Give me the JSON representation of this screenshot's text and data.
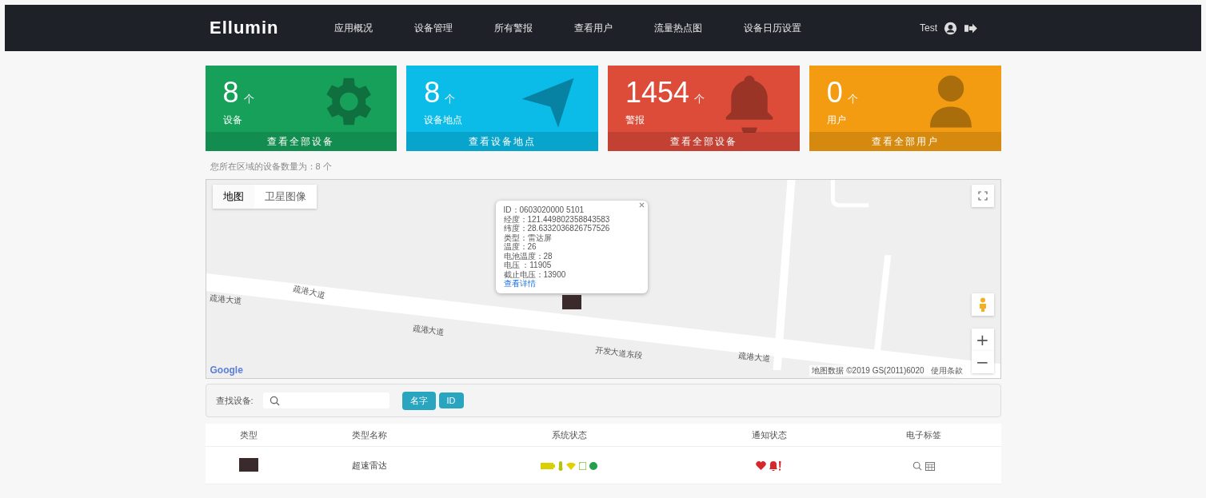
{
  "navbar": {
    "brand": "Ellumin",
    "items": [
      {
        "label": "应用概况"
      },
      {
        "label": "设备管理"
      },
      {
        "label": "所有警报"
      },
      {
        "label": "查看用户"
      },
      {
        "label": "流量热点图"
      },
      {
        "label": "设备日历设置"
      }
    ],
    "user": "Test"
  },
  "cards": [
    {
      "kind": "gear",
      "value": "8",
      "unit": "个",
      "label": "设备",
      "link": "查看全部设备",
      "color": "#16a05a"
    },
    {
      "kind": "navigation",
      "value": "8",
      "unit": "个",
      "label": "设备地点",
      "link": "查看设备地点",
      "color": "#0bbbe8"
    },
    {
      "kind": "bell",
      "value": "1454",
      "unit": "个",
      "label": "警报",
      "link": "查看全部设备",
      "color": "#dd4b39"
    },
    {
      "kind": "user",
      "value": "0",
      "unit": "个",
      "label": "用户",
      "link": "查看全部用户",
      "color": "#f39c12"
    }
  ],
  "region_note": "您所在区域的设备数量为：8 个",
  "map": {
    "tabs": [
      {
        "label": "地图",
        "selected": true
      },
      {
        "label": "卫星图像",
        "selected": false
      }
    ],
    "road_labels": [
      "疏港大道",
      "疏港大道",
      "疏港大道",
      "开发大道东段",
      "疏港大道"
    ],
    "popup": {
      "lines": [
        "ID：0603020000 5101",
        "经度：121.449802358843583",
        "纬度：28.6332036826757526",
        "类型：雷达屏",
        "温度：26",
        "电池温度：28",
        "电压 ：11905",
        "截止电压：13900"
      ],
      "link": "查看详情"
    },
    "logo": "Google",
    "attribution": "地图数据 ©2019 GS(2011)6020",
    "terms": "使用条款",
    "zoom_in": "+",
    "zoom_out": "−"
  },
  "search": {
    "label": "查找设备:",
    "buttons": [
      "名字",
      "ID"
    ]
  },
  "table": {
    "columns": [
      "类型",
      "类型名称",
      "系统状态",
      "通知状态",
      "电子标签"
    ],
    "rows": [
      {
        "name": "超速雷达"
      }
    ]
  }
}
